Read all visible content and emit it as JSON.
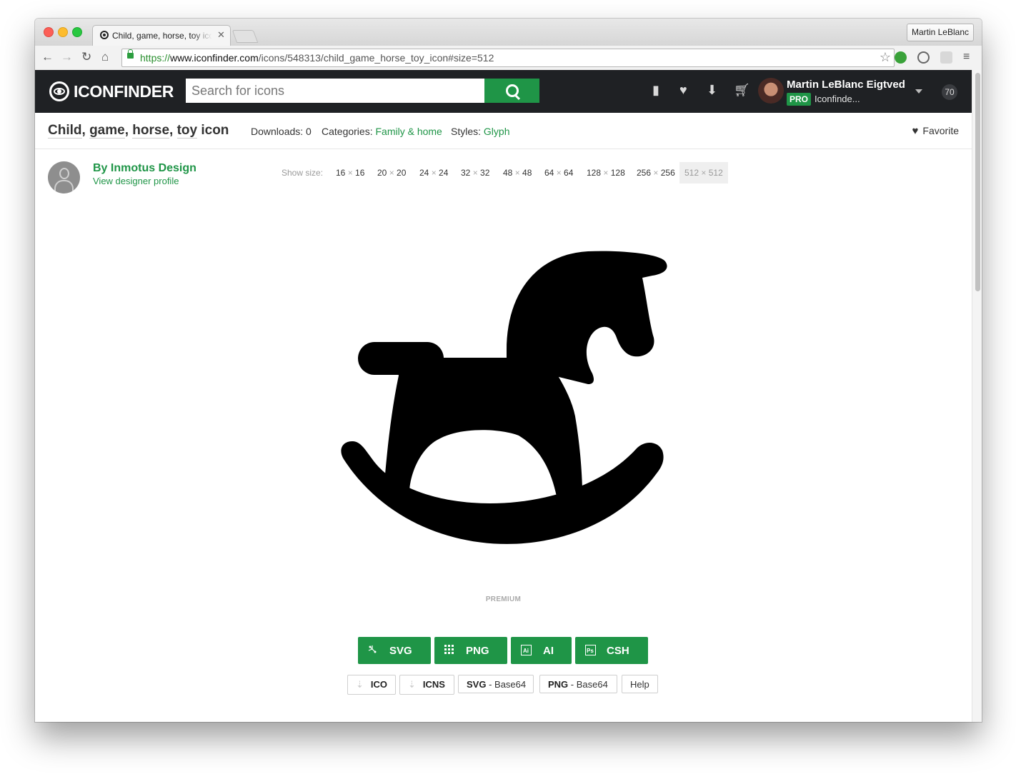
{
  "browser": {
    "tab_title": "Child, game, horse, toy icon",
    "profile_button": "Martin LeBlanc",
    "url_scheme": "https://",
    "url_host": "www.iconfinder.com",
    "url_path": "/icons/548313/child_game_horse_toy_icon#size=512"
  },
  "site_header": {
    "logo": "ICONFINDER",
    "search_placeholder": "Search for icons",
    "user_name": "Martin LeBlanc Eigtved",
    "pro_badge": "PRO",
    "user_org": "Iconfinde...",
    "notification_count": "70"
  },
  "icon_page": {
    "title_tags": [
      "Child",
      "game",
      "horse",
      "toy"
    ],
    "title_suffix": "icon",
    "downloads_label": "Downloads:",
    "downloads_value": "0",
    "categories_label": "Categories:",
    "category": "Family & home",
    "styles_label": "Styles:",
    "style": "Glyph",
    "favorite_label": "Favorite",
    "designer_name": "By Inmotus Design",
    "designer_link": "View designer profile",
    "show_size_label": "Show size:",
    "sizes": [
      {
        "w": "16",
        "h": "16"
      },
      {
        "w": "20",
        "h": "20"
      },
      {
        "w": "24",
        "h": "24"
      },
      {
        "w": "32",
        "h": "32"
      },
      {
        "w": "48",
        "h": "48"
      },
      {
        "w": "64",
        "h": "64"
      },
      {
        "w": "128",
        "h": "128"
      },
      {
        "w": "256",
        "h": "256"
      },
      {
        "w": "512",
        "h": "512"
      }
    ],
    "active_size": "512",
    "premium_label": "PREMIUM",
    "download_buttons": [
      "SVG",
      "PNG",
      "AI",
      "CSH"
    ],
    "secondary_buttons": [
      {
        "bold": "ICO",
        "rest": ""
      },
      {
        "bold": "ICNS",
        "rest": ""
      },
      {
        "bold": "SVG",
        "rest": " - Base64"
      },
      {
        "bold": "PNG",
        "rest": " - Base64"
      },
      {
        "bold": "",
        "rest": "Help"
      }
    ]
  },
  "icons": [
    "back-icon",
    "forward-icon",
    "reload-icon",
    "home-icon",
    "lock-icon",
    "star-icon",
    "menu-icon",
    "mug-icon",
    "heart-icon",
    "download-icon",
    "cart-icon",
    "search-icon"
  ],
  "colors": {
    "brand_green": "#1f9547",
    "header_dark": "#1f2124"
  }
}
